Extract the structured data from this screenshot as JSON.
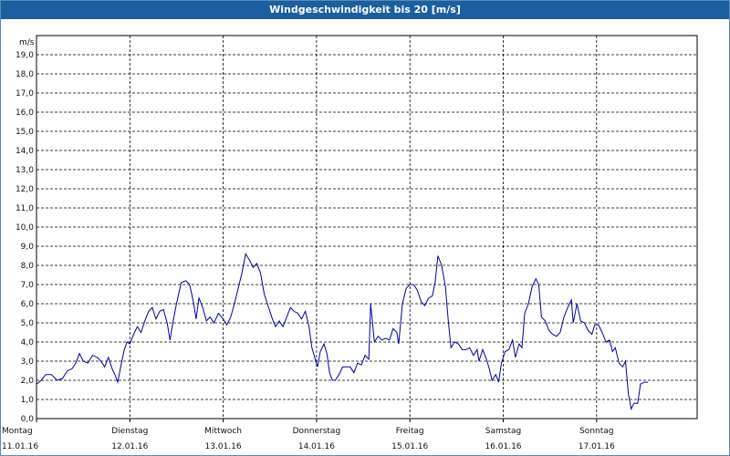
{
  "window": {
    "title": "Windgeschwindigkeit bis 20 [m/s]"
  },
  "chart_data": {
    "type": "line",
    "title": "Windgeschwindigkeit bis 20 [m/s]",
    "ylabel": "m/s",
    "ylim": [
      0,
      20
    ],
    "yticks": [
      "0,0",
      "1,0",
      "2,0",
      "3,0",
      "4,0",
      "5,0",
      "6,0",
      "7,0",
      "8,0",
      "9,0",
      "10,0",
      "11,0",
      "12,0",
      "13,0",
      "14,0",
      "15,0",
      "16,0",
      "17,0",
      "18,0",
      "19,0"
    ],
    "days": [
      {
        "name": "Montag",
        "date": "11.01.16"
      },
      {
        "name": "Dienstag",
        "date": "12.01.16"
      },
      {
        "name": "Mittwoch",
        "date": "13.01.16"
      },
      {
        "name": "Donnerstag",
        "date": "14.01.16"
      },
      {
        "name": "Freitag",
        "date": "15.01.16"
      },
      {
        "name": "Samstag",
        "date": "16.01.16"
      },
      {
        "name": "Sonntag",
        "date": "17.01.16"
      }
    ],
    "grid": true,
    "series_color": "#0000a0",
    "series": [
      {
        "x_unit": "days since 11.01.16 00:00",
        "points": [
          [
            0.0,
            1.8
          ],
          [
            0.05,
            2.0
          ],
          [
            0.1,
            2.3
          ],
          [
            0.16,
            2.3
          ],
          [
            0.22,
            2.0
          ],
          [
            0.28,
            2.1
          ],
          [
            0.33,
            2.5
          ],
          [
            0.38,
            2.6
          ],
          [
            0.42,
            2.9
          ],
          [
            0.46,
            3.4
          ],
          [
            0.5,
            3.0
          ],
          [
            0.55,
            2.9
          ],
          [
            0.6,
            3.3
          ],
          [
            0.65,
            3.2
          ],
          [
            0.69,
            3.0
          ],
          [
            0.73,
            2.7
          ],
          [
            0.77,
            3.2
          ],
          [
            0.81,
            2.6
          ],
          [
            0.84,
            2.3
          ],
          [
            0.87,
            1.9
          ],
          [
            0.91,
            2.9
          ],
          [
            0.94,
            3.6
          ],
          [
            0.97,
            4.0
          ],
          [
            1.0,
            3.9
          ],
          [
            1.04,
            4.4
          ],
          [
            1.08,
            4.8
          ],
          [
            1.12,
            4.5
          ],
          [
            1.16,
            5.1
          ],
          [
            1.2,
            5.6
          ],
          [
            1.24,
            5.8
          ],
          [
            1.28,
            5.2
          ],
          [
            1.32,
            5.6
          ],
          [
            1.36,
            5.7
          ],
          [
            1.4,
            5.0
          ],
          [
            1.43,
            4.1
          ],
          [
            1.46,
            5.0
          ],
          [
            1.5,
            6.0
          ],
          [
            1.55,
            7.1
          ],
          [
            1.6,
            7.2
          ],
          [
            1.64,
            7.0
          ],
          [
            1.68,
            6.1
          ],
          [
            1.71,
            5.2
          ],
          [
            1.74,
            6.3
          ],
          [
            1.78,
            5.8
          ],
          [
            1.82,
            5.1
          ],
          [
            1.86,
            5.3
          ],
          [
            1.9,
            5.0
          ],
          [
            1.95,
            5.5
          ],
          [
            2.0,
            5.2
          ],
          [
            2.04,
            4.9
          ],
          [
            2.08,
            5.3
          ],
          [
            2.12,
            6.0
          ],
          [
            2.16,
            6.8
          ],
          [
            2.2,
            7.6
          ],
          [
            2.24,
            8.6
          ],
          [
            2.28,
            8.3
          ],
          [
            2.32,
            7.9
          ],
          [
            2.36,
            8.1
          ],
          [
            2.4,
            7.6
          ],
          [
            2.44,
            6.5
          ],
          [
            2.48,
            5.9
          ],
          [
            2.52,
            5.3
          ],
          [
            2.56,
            4.8
          ],
          [
            2.6,
            5.1
          ],
          [
            2.64,
            4.8
          ],
          [
            2.68,
            5.3
          ],
          [
            2.72,
            5.8
          ],
          [
            2.76,
            5.6
          ],
          [
            2.8,
            5.5
          ],
          [
            2.84,
            5.2
          ],
          [
            2.88,
            5.6
          ],
          [
            2.92,
            4.8
          ],
          [
            2.95,
            3.7
          ],
          [
            2.98,
            3.2
          ],
          [
            3.01,
            2.7
          ],
          [
            3.04,
            3.5
          ],
          [
            3.08,
            3.9
          ],
          [
            3.11,
            3.4
          ],
          [
            3.14,
            2.4
          ],
          [
            3.17,
            2.0
          ],
          [
            3.2,
            2.0
          ],
          [
            3.24,
            2.3
          ],
          [
            3.28,
            2.7
          ],
          [
            3.32,
            2.7
          ],
          [
            3.36,
            2.7
          ],
          [
            3.4,
            2.4
          ],
          [
            3.44,
            2.9
          ],
          [
            3.48,
            2.8
          ],
          [
            3.52,
            3.3
          ],
          [
            3.56,
            3.1
          ],
          [
            3.58,
            6.0
          ],
          [
            3.62,
            4.0
          ],
          [
            3.66,
            4.3
          ],
          [
            3.7,
            4.1
          ],
          [
            3.74,
            4.2
          ],
          [
            3.78,
            4.1
          ],
          [
            3.82,
            4.7
          ],
          [
            3.86,
            4.5
          ],
          [
            3.88,
            3.9
          ],
          [
            3.92,
            6.0
          ],
          [
            3.96,
            6.8
          ],
          [
            4.0,
            7.0
          ],
          [
            4.04,
            7.0
          ],
          [
            4.08,
            6.7
          ],
          [
            4.12,
            6.1
          ],
          [
            4.16,
            5.9
          ],
          [
            4.2,
            6.3
          ],
          [
            4.24,
            6.4
          ],
          [
            4.27,
            7.1
          ],
          [
            4.3,
            8.5
          ],
          [
            4.34,
            8.0
          ],
          [
            4.38,
            6.9
          ],
          [
            4.41,
            5.2
          ],
          [
            4.44,
            3.7
          ],
          [
            4.48,
            4.0
          ],
          [
            4.52,
            3.9
          ],
          [
            4.56,
            3.6
          ],
          [
            4.6,
            3.6
          ],
          [
            4.64,
            3.7
          ],
          [
            4.68,
            3.3
          ],
          [
            4.72,
            3.6
          ],
          [
            4.74,
            3.0
          ],
          [
            4.78,
            3.6
          ],
          [
            4.82,
            3.1
          ],
          [
            4.85,
            2.6
          ],
          [
            4.88,
            2.0
          ],
          [
            4.92,
            2.3
          ],
          [
            4.95,
            1.9
          ],
          [
            4.98,
            2.9
          ],
          [
            5.02,
            3.5
          ],
          [
            5.06,
            3.6
          ],
          [
            5.1,
            4.1
          ],
          [
            5.13,
            3.2
          ],
          [
            5.17,
            3.9
          ],
          [
            5.2,
            3.7
          ],
          [
            5.23,
            5.5
          ],
          [
            5.27,
            6.0
          ],
          [
            5.31,
            6.9
          ],
          [
            5.35,
            7.3
          ],
          [
            5.38,
            7.0
          ],
          [
            5.41,
            5.3
          ],
          [
            5.45,
            5.1
          ],
          [
            5.49,
            4.6
          ],
          [
            5.53,
            4.4
          ],
          [
            5.57,
            4.3
          ],
          [
            5.61,
            4.5
          ],
          [
            5.65,
            5.3
          ],
          [
            5.69,
            5.8
          ],
          [
            5.73,
            6.2
          ],
          [
            5.75,
            5.0
          ],
          [
            5.79,
            6.0
          ],
          [
            5.83,
            5.1
          ],
          [
            5.87,
            5.0
          ],
          [
            5.91,
            4.6
          ],
          [
            5.95,
            4.4
          ],
          [
            5.98,
            4.9
          ],
          [
            6.02,
            4.9
          ],
          [
            6.06,
            4.5
          ],
          [
            6.1,
            4.0
          ],
          [
            6.14,
            4.1
          ],
          [
            6.17,
            3.5
          ],
          [
            6.2,
            3.7
          ],
          [
            6.24,
            2.9
          ],
          [
            6.28,
            2.7
          ],
          [
            6.31,
            3.0
          ],
          [
            6.34,
            1.3
          ],
          [
            6.37,
            0.5
          ],
          [
            6.4,
            0.8
          ],
          [
            6.44,
            0.8
          ],
          [
            6.47,
            1.8
          ],
          [
            6.51,
            1.9
          ],
          [
            6.55,
            1.9
          ]
        ]
      }
    ]
  }
}
